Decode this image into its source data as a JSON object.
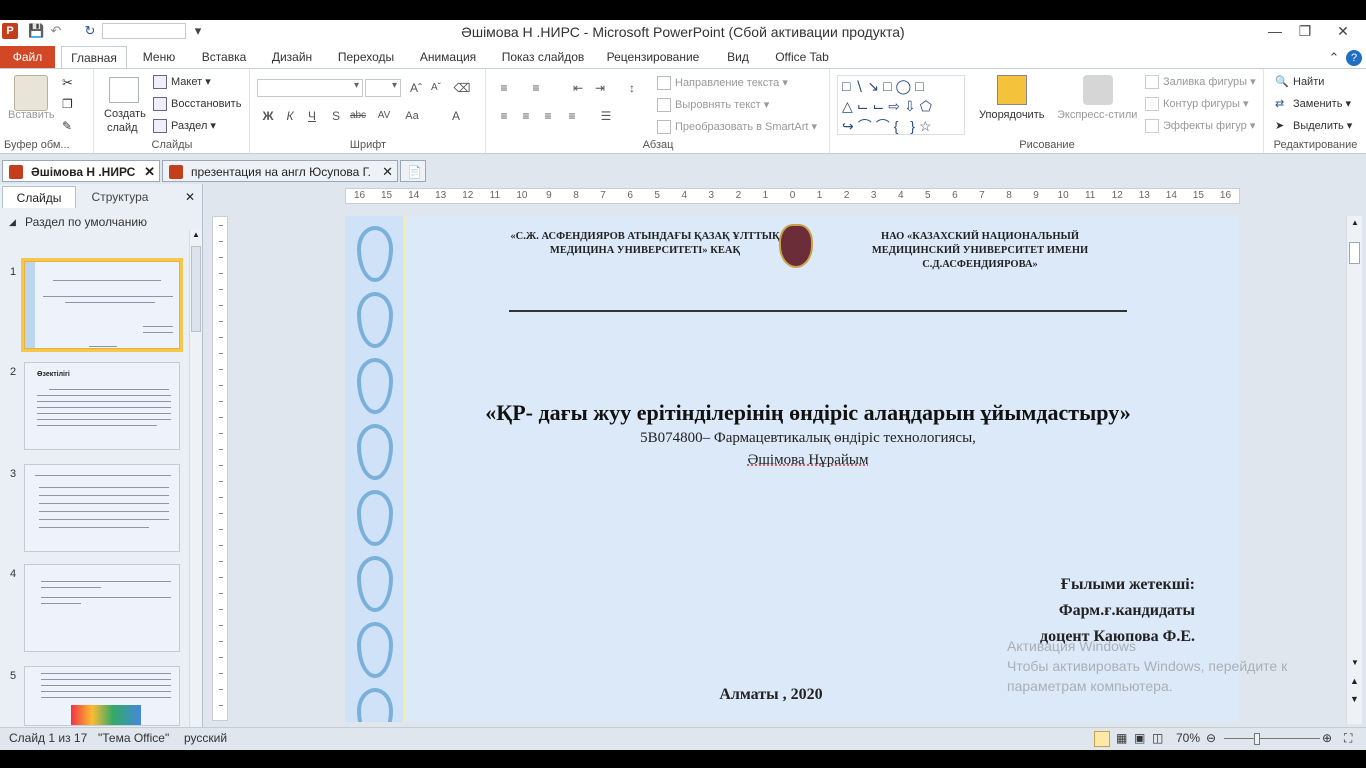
{
  "window": {
    "title": "Әшімова Н .НИРС  -  Microsoft PowerPoint (Сбой активации продукта)",
    "app_icon": "P"
  },
  "ribbon_tabs": [
    "Файл",
    "Главная",
    "Меню",
    "Вставка",
    "Дизайн",
    "Переходы",
    "Анимация",
    "Показ слайдов",
    "Рецензирование",
    "Вид",
    "Office Tab"
  ],
  "ribbon": {
    "clipboard": {
      "paste": "Вставить",
      "label": "Буфер обм..."
    },
    "slides": {
      "new_slide_1": "Создать",
      "new_slide_2": "слайд",
      "layout": "Макет",
      "reset": "Восстановить",
      "section": "Раздел",
      "label": "Слайды"
    },
    "font": {
      "label": "Шрифт"
    },
    "paragraph": {
      "text_direction": "Направление текста",
      "align_text": "Выровнять текст",
      "smartart": "Преобразовать в SmartArt",
      "label": "Абзац"
    },
    "drawing": {
      "arrange": "Упорядочить",
      "quick_styles": "Экспресс-стили",
      "shape_fill": "Заливка фигуры",
      "shape_outline": "Контур фигуры",
      "shape_effects": "Эффекты фигур",
      "label": "Рисование"
    },
    "editing": {
      "find": "Найти",
      "replace": "Заменить",
      "select": "Выделить",
      "label": "Редактирование"
    }
  },
  "doc_tabs": [
    {
      "label": "Әшімова Н .НИРС"
    },
    {
      "label": "презентация на англ Юсупова Г."
    }
  ],
  "left_pane": {
    "tab_slides": "Слайды",
    "tab_outline": "Структура",
    "section": "Раздел по умолчанию",
    "thumbs": [
      {
        "num": "1",
        "title": ""
      },
      {
        "num": "2",
        "title": "Өзектілігі"
      },
      {
        "num": "3",
        "title": ""
      },
      {
        "num": "4",
        "title": ""
      },
      {
        "num": "5",
        "title": ""
      }
    ]
  },
  "ruler": {
    "h_ticks": [
      "16",
      "15",
      "14",
      "13",
      "12",
      "11",
      "10",
      "9",
      "8",
      "7",
      "6",
      "5",
      "4",
      "3",
      "2",
      "1",
      "0",
      "1",
      "2",
      "3",
      "4",
      "5",
      "6",
      "7",
      "8",
      "9",
      "10",
      "11",
      "12",
      "13",
      "14",
      "15",
      "16"
    ]
  },
  "slide": {
    "header_left": "«С.Ж. АСФЕНДИЯРОВ АТЫНДАҒЫ ҚАЗАҚ ҰЛТТЫҚ  МЕДИЦИНА УНИВЕРСИТЕТІ»  КЕАҚ",
    "header_right": "НАО «КАЗАХСКИЙ НАЦИОНАЛЬНЫЙ МЕДИЦИНСКИЙ УНИВЕРСИТЕТ  ИМЕНИ С.Д.АСФЕНДИЯРОВА»",
    "title": "«ҚР- дағы жуу ерітінділерінің өндіріс алаңдарын ұйымдастыру»",
    "subtitle": "5В074800–  Фармацевтикалық өндіріс технологиясы,",
    "author": "Әшімова Нұрайым",
    "advisor_1": "Ғылыми жетекші:",
    "advisor_2": "Фарм.ғ.кандидаты",
    "advisor_3": "доцент Каюпова Ф.Е.",
    "footer": "Алматы , 2020"
  },
  "watermark": {
    "line1": "Активация Windows",
    "line2": "Чтобы активировать Windows, перейдите к",
    "line3": "параметрам компьютера."
  },
  "status": {
    "slide": "Слайд 1 из 17",
    "theme": "\"Тема Office\"",
    "lang": "русский",
    "zoom": "70%"
  },
  "colors": {
    "file_tab": "#d24726",
    "accent": "#2b5797",
    "slide_bg": "#dce9f8"
  }
}
